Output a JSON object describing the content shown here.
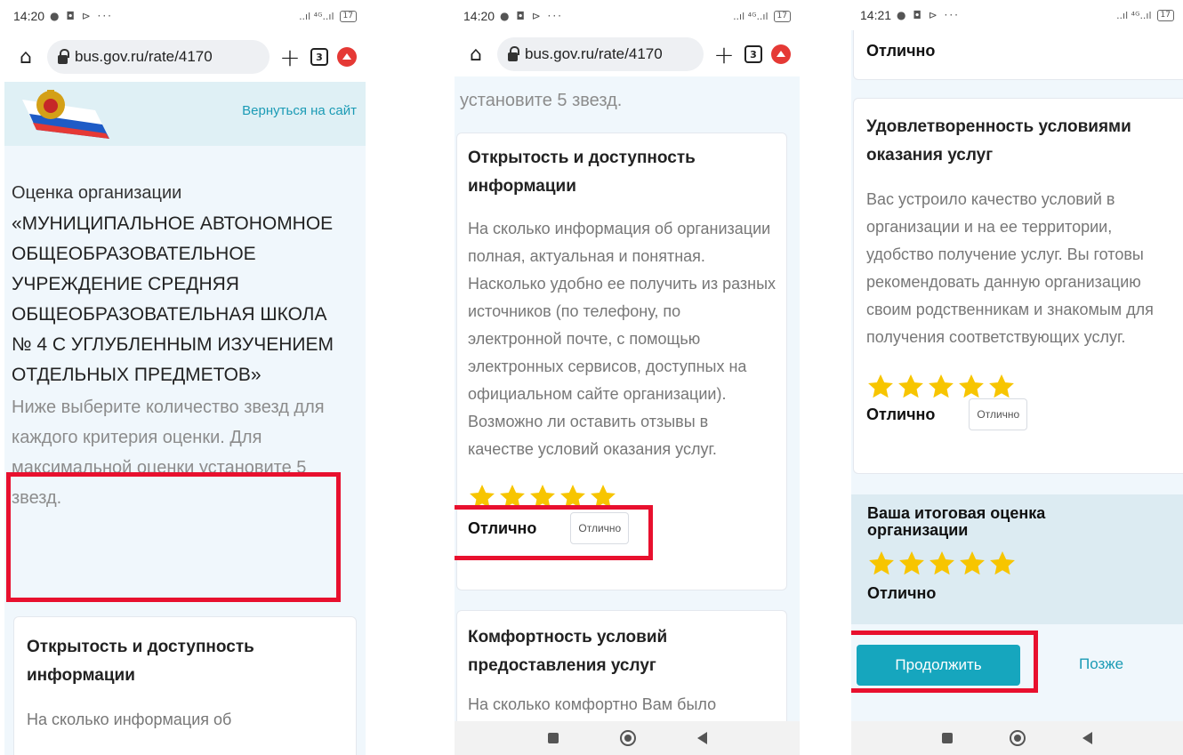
{
  "status": {
    "time1": "14:20",
    "time2": "14:20",
    "time3": "14:21",
    "icons": "● ◘ ⊳ ···",
    "signal": "..ıl ⁴ᴳ..ıl",
    "battery": "17"
  },
  "browser": {
    "url": "bus.gov.ru/rate/4170",
    "tab_count": "3"
  },
  "header": {
    "back_link": "Вернуться на сайт"
  },
  "org": {
    "label": "Оценка организации",
    "name": "«МУНИЦИПАЛЬНОЕ АВТОНОМНОЕ ОБЩЕОБРАЗОВАТЕЛЬНОЕ УЧРЕЖДЕНИЕ СРЕДНЯЯ ОБЩЕОБРАЗОВАТЕЛЬНАЯ ШКОЛА № 4 С УГЛУБЛЕННЫМ ИЗУЧЕНИЕМ ОТДЕЛЬНЫХ ПРЕДМЕТОВ»",
    "hint": "Ниже выберите количество звезд для каждого критерия оценки. Для максимальной оценки установите 5 звезд.",
    "hint_tail": "установите 5 звезд."
  },
  "criteria": [
    {
      "title": "Открытость и доступность информации",
      "text_short": "На сколько информация об",
      "text": "На сколько информация об организации полная, актуальная и понятная. Насколько удобно ее получить из разных источников (по телефону, по электронной почте, с помощью электронных сервисов, доступных на официальном сайте организации). Возможно ли оставить отзывы в качестве условий оказания услуг.",
      "rating": 5,
      "grade": "Отлично",
      "grade_chip": "Отлично"
    },
    {
      "title": "Комфортность условий предоставления услуг",
      "text_short": "На сколько комфортно Вам было"
    },
    {
      "title": "Удовлетворенность условиями оказания услуг",
      "text": "Вас устроило качество условий в организации и на ее территории, удобство получение услуг. Вы готовы рекомендовать данную организацию своим родственникам и знакомым для получения соответствующих услуг.",
      "rating": 5,
      "grade": "Отлично",
      "grade_chip": "Отлично"
    }
  ],
  "prev_grade": "Отлично",
  "final": {
    "title": "Ваша итоговая оценка организации",
    "rating": 5,
    "grade": "Отлично"
  },
  "actions": {
    "continue": "Продолжить",
    "later": "Позже"
  },
  "colors": {
    "star": "#f7c500",
    "accent": "#16a6be",
    "highlight": "#e8102e"
  }
}
